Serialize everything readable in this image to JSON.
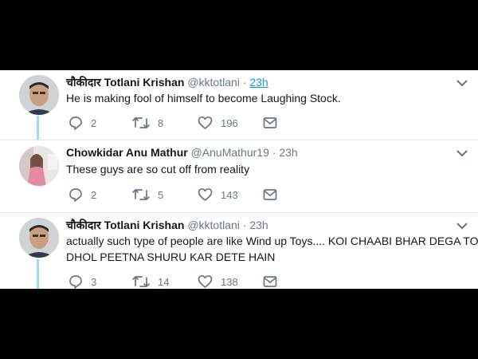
{
  "tweets": [
    {
      "name": "चौकीदार Totlani Krishan",
      "handle": "@kktotlani",
      "dot": "·",
      "time": "23h",
      "text_lines": [
        "He is making fool of himself to become Laughing Stock."
      ],
      "replies": "2",
      "retweets": "8",
      "likes": "196"
    },
    {
      "name": "Chowkidar Anu Mathur",
      "handle": "@AnuMathur19",
      "dot": "·",
      "time": "23h",
      "text_lines": [
        "These guys are so cut off from reality"
      ],
      "replies": "2",
      "retweets": "5",
      "likes": "143"
    },
    {
      "name": "चौकीदार Totlani Krishan",
      "handle": "@kktotlani",
      "dot": "·",
      "time": "23h",
      "text_lines": [
        "actually such type of people are like Wind up Toys.... KOI CHAABI BHAR DEGA TO",
        "DHOL PEETNA SHURU KAR DETE HAIN"
      ],
      "replies": "3",
      "retweets": "14",
      "likes": "138"
    }
  ],
  "icons": {
    "reply": "reply-icon",
    "retweet": "retweet-icon",
    "like": "heart-icon",
    "dm": "envelope-icon",
    "menu": "chevron-down-icon"
  },
  "colors": {
    "background": "#000000",
    "card": "#ffffff",
    "text": "#14171a",
    "muted": "#657786",
    "link": "#1b95e0",
    "thread": "#a3d8f5",
    "divider": "#e1e8ed"
  }
}
